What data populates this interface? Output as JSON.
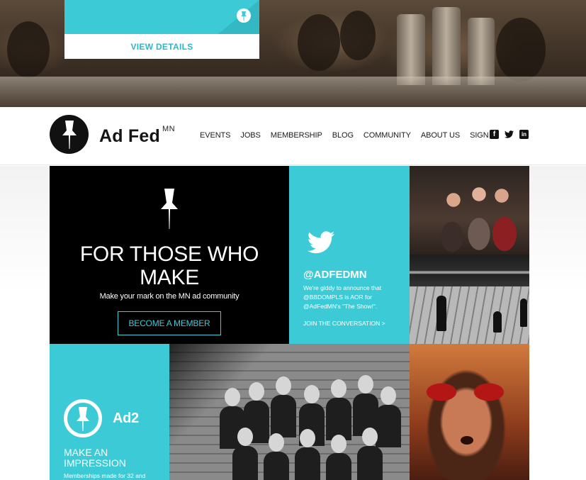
{
  "event_card": {
    "details_label": "VIEW DETAILS"
  },
  "header": {
    "brand": "Ad Fed",
    "brand_suffix": "MN",
    "nav": [
      "EVENTS",
      "JOBS",
      "MEMBERSHIP",
      "BLOG",
      "COMMUNITY",
      "ABOUT US",
      "SIGN IN"
    ],
    "social_icons": [
      "facebook-icon",
      "twitter-icon",
      "linkedin-icon"
    ]
  },
  "hero_tile": {
    "headline_line1": "FOR THOSE WHO",
    "headline_line2": "MAKE",
    "subtitle": "Make your mark on the MN ad community",
    "cta": "BECOME A MEMBER"
  },
  "tweet_tile": {
    "handle": "@ADFEDMN",
    "body": "We're giddy to announce that @BBDOMPLS is AOR for @AdFedMN's \"The Show!\".",
    "link": "JOIN THE CONVERSATION >"
  },
  "ad2_tile": {
    "logo_text": "Ad2",
    "title": "MAKE AN IMPRESSION",
    "desc": "Memberships made for 32 and"
  },
  "colors": {
    "accent": "#3ccbd6",
    "dark": "#000000"
  }
}
